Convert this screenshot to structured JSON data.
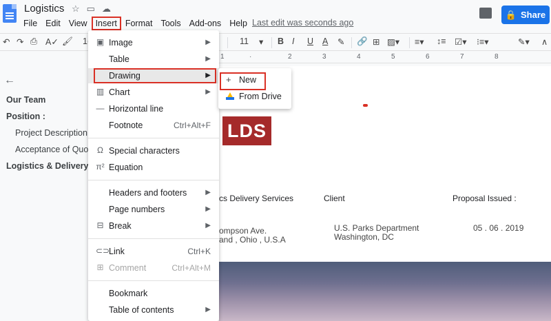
{
  "app": {
    "title": "Logistics",
    "title_icons": [
      "star-icon",
      "folder-icon",
      "cloud-icon"
    ],
    "last_edit": "Last edit was seconds ago",
    "share_label": "Share"
  },
  "menubar": [
    "File",
    "Edit",
    "View",
    "Insert",
    "Format",
    "Tools",
    "Add-ons",
    "Help"
  ],
  "toolbar": {
    "font_size_left": "1(",
    "font_size": "11"
  },
  "ruler_marks": [
    "2",
    "1",
    "1",
    "2",
    "3",
    "4",
    "5",
    "6",
    "7",
    "8"
  ],
  "outline": {
    "items": [
      {
        "label": "Our Team"
      },
      {
        "label": "Position :"
      },
      {
        "label": "Project Description"
      },
      {
        "label": "Acceptance of Quote"
      },
      {
        "label": "Logistics & Delivery Se"
      }
    ]
  },
  "insert_menu": {
    "items": [
      {
        "label": "Image",
        "icon": "image-icon",
        "submenu": true
      },
      {
        "label": "Table",
        "submenu": true
      },
      {
        "label": "Drawing",
        "submenu": true,
        "highlighted": true
      },
      {
        "label": "Chart",
        "icon": "chart-icon",
        "submenu": true
      },
      {
        "label": "Horizontal line",
        "icon": "horizontal-line-icon"
      },
      {
        "label": "Footnote",
        "shortcut": "Ctrl+Alt+F"
      },
      {
        "label": "Special characters",
        "icon": "omega-icon"
      },
      {
        "label": "Equation",
        "icon": "pi-icon"
      },
      {
        "label": "Headers and footers",
        "submenu": true
      },
      {
        "label": "Page numbers",
        "submenu": true
      },
      {
        "label": "Break",
        "icon": "break-icon",
        "submenu": true
      },
      {
        "label": "Link",
        "icon": "link-icon",
        "shortcut": "Ctrl+K"
      },
      {
        "label": "Comment",
        "icon": "comment-icon",
        "shortcut": "Ctrl+Alt+M",
        "disabled": true
      },
      {
        "label": "Bookmark"
      },
      {
        "label": "Table of contents",
        "submenu": true
      }
    ]
  },
  "drawing_submenu": {
    "items": [
      {
        "label": "New",
        "icon": "plus-icon",
        "highlighted": true
      },
      {
        "label": "From Drive",
        "icon": "google-drive-icon"
      }
    ]
  },
  "document": {
    "logo_text": "LDS",
    "col1_header": "cs Delivery Services",
    "col2_header": "Client",
    "col3_header": "Proposal Issued :",
    "addr1": "ompson Ave.",
    "addr2": "and , Ohio , U.S.A",
    "client1": "U.S. Parks Department",
    "client2": "Washington, DC",
    "date": "05 . 06 . 2019"
  },
  "colors": {
    "accent": "#1a73e8",
    "highlight_box": "#d93025",
    "logo_bg": "#a52a2a"
  }
}
